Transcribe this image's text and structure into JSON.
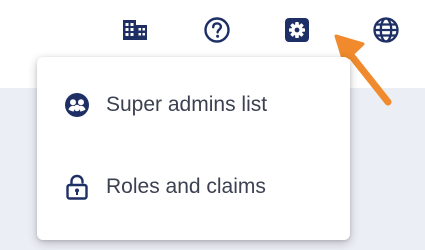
{
  "header": {
    "icons": [
      {
        "name": "building-icon",
        "label": "Organization"
      },
      {
        "name": "help-icon",
        "label": "Help"
      },
      {
        "name": "settings-icon",
        "label": "Settings"
      },
      {
        "name": "globe-icon",
        "label": "Language"
      }
    ]
  },
  "settings_menu": {
    "items": [
      {
        "icon": "user-group-icon",
        "label": "Super admins list"
      },
      {
        "icon": "lock-icon",
        "label": "Roles and claims"
      }
    ]
  },
  "colors": {
    "icon": "#1e2f66",
    "arrow": "#f08a2c",
    "menu_text": "#3b4151",
    "page_background": "#eceef6"
  }
}
